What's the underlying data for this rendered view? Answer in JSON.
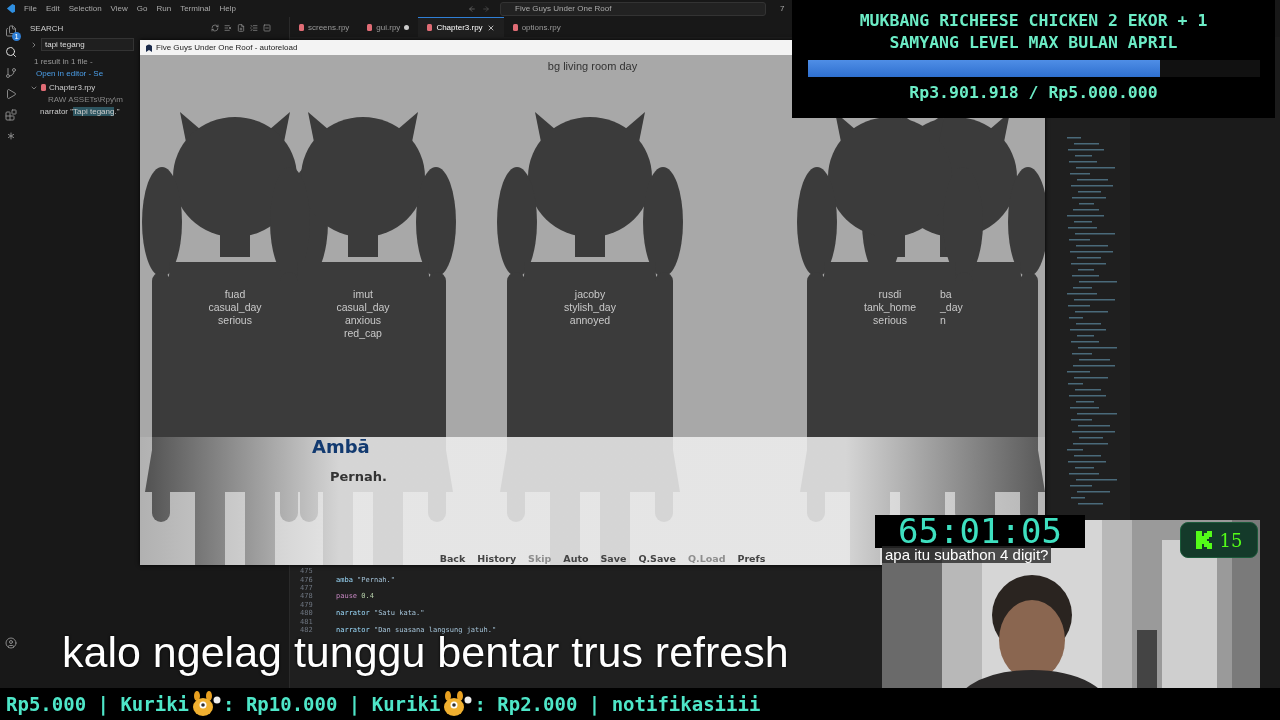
{
  "titlebar": {
    "menus": [
      "File",
      "Edit",
      "Selection",
      "View",
      "Go",
      "Run",
      "Terminal",
      "Help"
    ],
    "command_center": "Five Guys Under One Roof",
    "badge": "7"
  },
  "activity_bar": {
    "explorer_badge": "1"
  },
  "search_panel": {
    "title": "SEARCH",
    "query": "tapi tegang",
    "summary": "1 result in 1 file -",
    "summary_link": "Open in editor - Se",
    "result_file": {
      "name": "Chapter3.rpy",
      "path": "RAW ASSETs\\Rpy\\m"
    },
    "match": {
      "prefix": "narrator \"",
      "match": "Tapi tegang",
      "suffix": ".\""
    }
  },
  "editor_tabs": [
    {
      "label": "screens.rpy",
      "selected": false,
      "modified": false
    },
    {
      "label": "gui.rpy",
      "selected": false,
      "modified": true
    },
    {
      "label": "Chapter3.rpy",
      "selected": true,
      "modified": false
    },
    {
      "label": "options.rpy",
      "selected": false,
      "modified": false
    }
  ],
  "code_lines": [
    {
      "number": "475"
    },
    {
      "number": "476",
      "tokens": [
        {
          "kind": "name",
          "text": "amba"
        },
        {
          "kind": "string",
          "text": "\"Pernah.\""
        }
      ]
    },
    {
      "number": "477"
    },
    {
      "number": "478",
      "tokens": [
        {
          "kind": "keyword",
          "text": "pause"
        },
        {
          "kind": "number",
          "text": "0.4"
        }
      ]
    },
    {
      "number": "479"
    },
    {
      "number": "480",
      "tokens": [
        {
          "kind": "name",
          "text": "narrator"
        },
        {
          "kind": "string",
          "text": "\"Satu kata.\""
        }
      ]
    },
    {
      "number": "481"
    },
    {
      "number": "482",
      "tokens": [
        {
          "kind": "name",
          "text": "narrator"
        },
        {
          "kind": "string",
          "text": "\"Dan suasana langsung jatuh.\""
        }
      ]
    }
  ],
  "game_window": {
    "title": "Five Guys Under One Roof - autoreload",
    "scene": "bg living room day",
    "characters": [
      {
        "labels": [
          "fuad",
          "casual_day",
          "serious"
        ]
      },
      {
        "labels": [
          "imut",
          "casual_day",
          "anxious",
          "red_cap"
        ]
      },
      {
        "labels": [
          "jacoby",
          "stylish_day",
          "annoyed"
        ]
      },
      {
        "labels": [
          "rusdi",
          "tank_home",
          "serious"
        ]
      },
      {
        "labels": [
          "ba",
          "_day",
          "n"
        ]
      }
    ],
    "dialogue": {
      "speaker": "Ambā",
      "text": "Pernah."
    },
    "quick_menu": [
      {
        "label": "Back",
        "disabled": false
      },
      {
        "label": "History",
        "disabled": false
      },
      {
        "label": "Skip",
        "disabled": true
      },
      {
        "label": "Auto",
        "disabled": false
      },
      {
        "label": "Save",
        "disabled": false
      },
      {
        "label": "Q.Save",
        "disabled": false
      },
      {
        "label": "Q.Load",
        "disabled": true
      },
      {
        "label": "Prefs",
        "disabled": false
      }
    ]
  },
  "donation_goal": {
    "title_lines": [
      "MUKBANG RICHEESE CHICKEN 2 EKOR + 1",
      "SAMYANG LEVEL MAX BULAN APRIL"
    ],
    "level": 0.78,
    "amount": "Rp3.901.918 / Rp5.000.000"
  },
  "timer": "65:01:05",
  "chat_message": "apa itu subathon 4 digit?",
  "viewer_badge": "15",
  "subtitle": "kalo ngelag tunggu bentar trus refresh",
  "ticker": [
    {
      "text": "Rp5.000 | Kuriki",
      "icon": true
    },
    {
      "text": ": Rp10.000 | Kuriki",
      "icon": true
    },
    {
      "text": ": Rp2.000 | notifikasiiii",
      "icon": false
    }
  ]
}
